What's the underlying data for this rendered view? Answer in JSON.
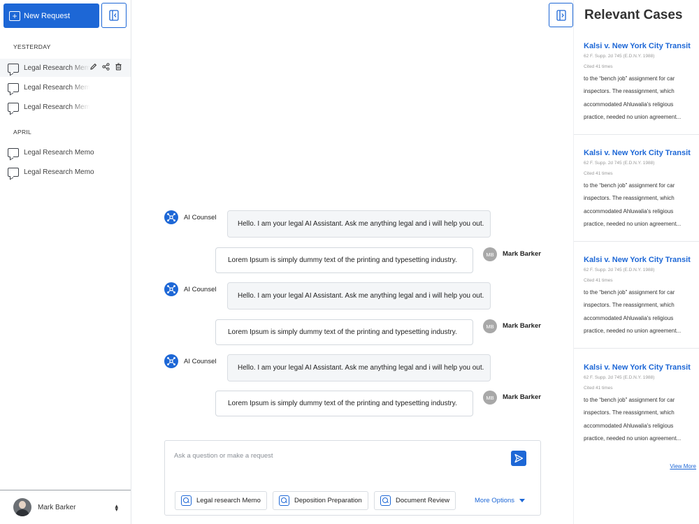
{
  "sidebar": {
    "new_request_label": "New Request",
    "sections": [
      {
        "title": "YESTERDAY",
        "items": [
          "Legal Research Memo",
          "Legal Research Memo",
          "Legal Research Memo"
        ]
      },
      {
        "title": "APRIL",
        "items": [
          "Legal Research Memo",
          "Legal Research Memo"
        ]
      }
    ],
    "user": {
      "name": "Mark Barker"
    }
  },
  "chat": {
    "messages": [
      {
        "from": "ai",
        "sender": "AI Counsel",
        "text": "Hello. I am your legal AI Assistant. Ask me anything legal and i will help you out."
      },
      {
        "from": "user",
        "initials": "MB",
        "sender": "Mark Barker",
        "text": "Lorem Ipsum is simply dummy text of the printing and typesetting industry."
      },
      {
        "from": "ai",
        "sender": "AI Counsel",
        "text": "Hello. I am your legal AI Assistant. Ask me anything legal and i will help you out."
      },
      {
        "from": "user",
        "initials": "MB",
        "sender": "Mark Barker",
        "text": "Lorem Ipsum is simply dummy text of the printing and typesetting industry."
      },
      {
        "from": "ai",
        "sender": "AI Counsel",
        "text": "Hello. I am your legal AI Assistant. Ask me anything legal and i will help you out."
      },
      {
        "from": "user",
        "initials": "MB",
        "sender": "Mark Barker",
        "text": "Lorem Ipsum is simply dummy text of the printing and typesetting industry."
      }
    ],
    "composer": {
      "placeholder": "Ask a question or make a request",
      "chips": [
        "Legal research Memo",
        "Deposition Preparation",
        "Document Review"
      ],
      "more_options": "More Options"
    }
  },
  "cases": {
    "title": "Relevant Cases",
    "items": [
      {
        "name": "Kalsi v. New York City Transit",
        "citation": "62 F. Supp. 2d 745 (E.D.N.Y. 1988)",
        "cited": "Cited 41 times",
        "excerpt": "to the “bench job” assignment for car inspectors. The reassignment, which accommodated Ahluwalia's religious practice, needed no union agreement..."
      },
      {
        "name": "Kalsi v. New York City Transit",
        "citation": "62 F. Supp. 2d 745 (E.D.N.Y. 1988)",
        "cited": "Cited 41 times",
        "excerpt": "to the “bench job” assignment for car inspectors. The reassignment, which accommodated Ahluwalia's religious practice, needed no union agreement..."
      },
      {
        "name": "Kalsi v. New York City Transit",
        "citation": "62 F. Supp. 2d 745 (E.D.N.Y. 1988)",
        "cited": "Cited 41 times",
        "excerpt": "to the “bench job” assignment for car inspectors. The reassignment, which accommodated Ahluwalia's religious practice, needed no union agreement..."
      },
      {
        "name": "Kalsi v. New York City Transit",
        "citation": "62 F. Supp. 2d 745 (E.D.N.Y. 1988)",
        "cited": "Cited 41 times",
        "excerpt": "to the “bench job” assignment for car inspectors. The reassignment, which accommodated Ahluwalia's religious practice, needed no union agreement..."
      }
    ],
    "view_more": "View More"
  },
  "colors": {
    "accent": "#1d67d6",
    "bubble_ai": "#f4f6f8",
    "badge": "#a8a8a8"
  }
}
